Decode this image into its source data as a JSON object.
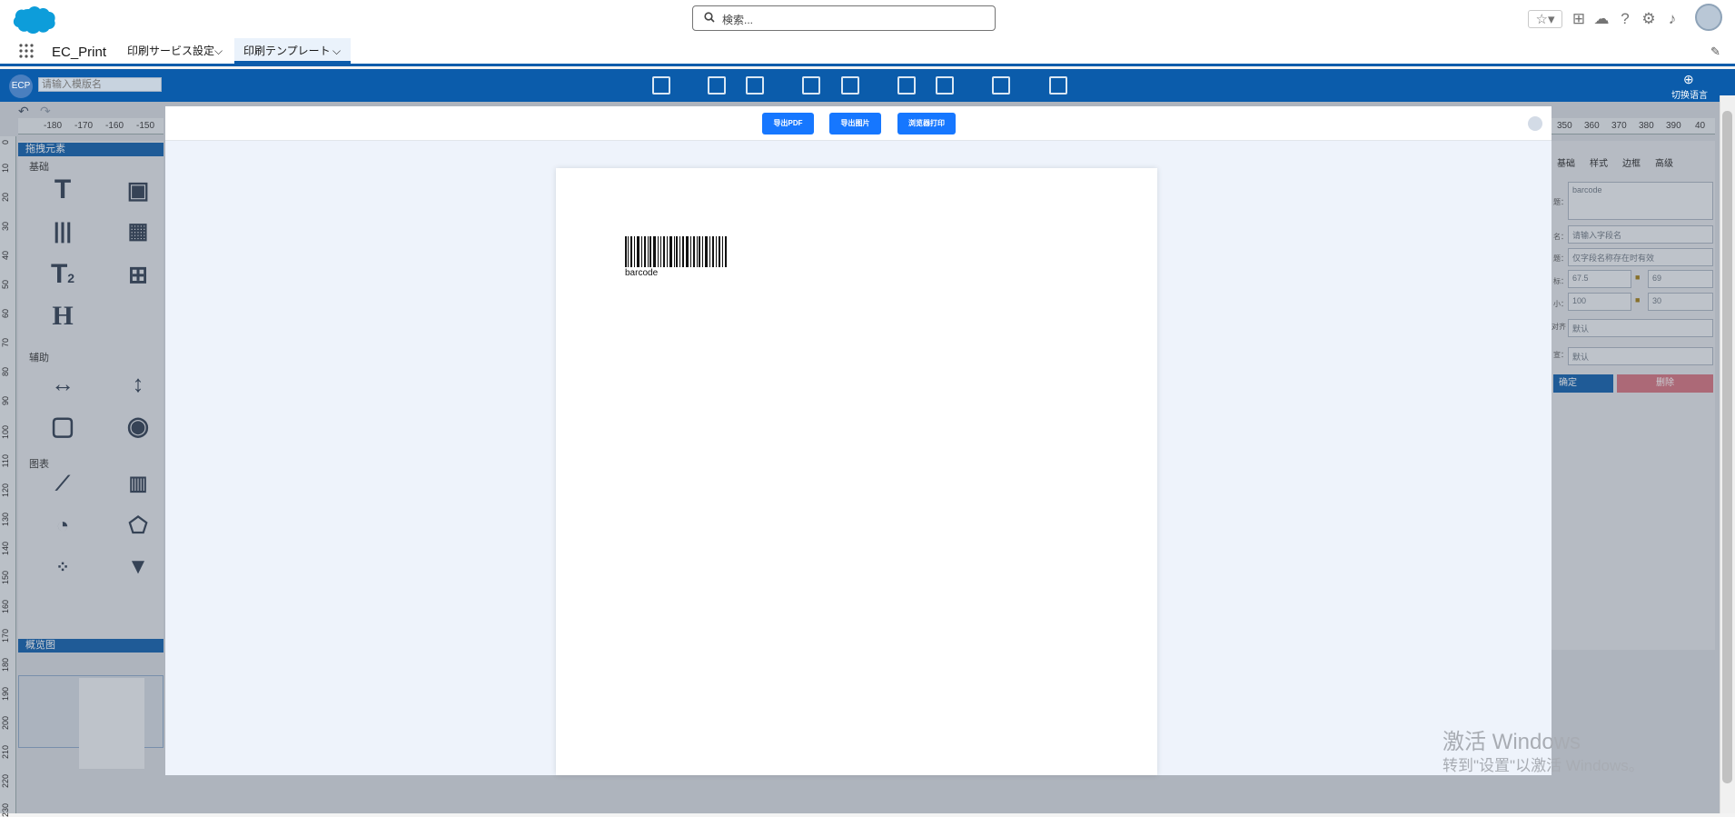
{
  "app": {
    "name": "EC_Print"
  },
  "search": {
    "placeholder": "検索..."
  },
  "tabs": [
    {
      "label": "印刷サービス設定"
    },
    {
      "label": "印刷テンプレート"
    }
  ],
  "toolbar": {
    "logo_text": "ECP",
    "template_name_placeholder": "请输入模版名",
    "switch_language": "切换语言"
  },
  "ruler": {
    "top_ticks_left": [
      "-180",
      "-170",
      "-160",
      "-150"
    ],
    "top_ticks_right": [
      "350",
      "360",
      "370",
      "380",
      "390",
      "40"
    ],
    "left_ticks": [
      "0",
      "10",
      "20",
      "30",
      "40",
      "50",
      "60",
      "70",
      "80",
      "90",
      "100",
      "110",
      "120",
      "130",
      "140",
      "150",
      "160",
      "170",
      "180",
      "190",
      "200",
      "210",
      "220",
      "230"
    ]
  },
  "left_panel": {
    "header": "拖拽元素",
    "section_basic": "基础",
    "section_aux": "辅助",
    "section_chart": "图表",
    "overview_header": "概览图"
  },
  "right_panel": {
    "tabs": [
      "基础",
      "样式",
      "边框",
      "高级"
    ],
    "labels": [
      "题：",
      "名：",
      "题：",
      "标：",
      "小：",
      "对齐",
      "宣："
    ],
    "title_value": "barcode",
    "field_name_placeholder": "请输入字段名",
    "field_hint": "仅字段名称存在时有效",
    "x": "67.5",
    "y": "69",
    "width": "100",
    "height": "30",
    "select1": "默认",
    "select2": "默认",
    "confirm": "确定",
    "delete": "删除"
  },
  "modal": {
    "export_pdf": "导出PDF",
    "export_image": "导出图片",
    "browser_print": "浏览器打印"
  },
  "preview": {
    "barcode_text": "barcode"
  },
  "watermark": {
    "line1": "激活 Windows",
    "line2": "转到\"设置\"以激活 Windows。"
  },
  "colors": {
    "brand_blue": "#0b5cab",
    "button_blue": "#1677ff",
    "delete_red": "#d4707d"
  }
}
